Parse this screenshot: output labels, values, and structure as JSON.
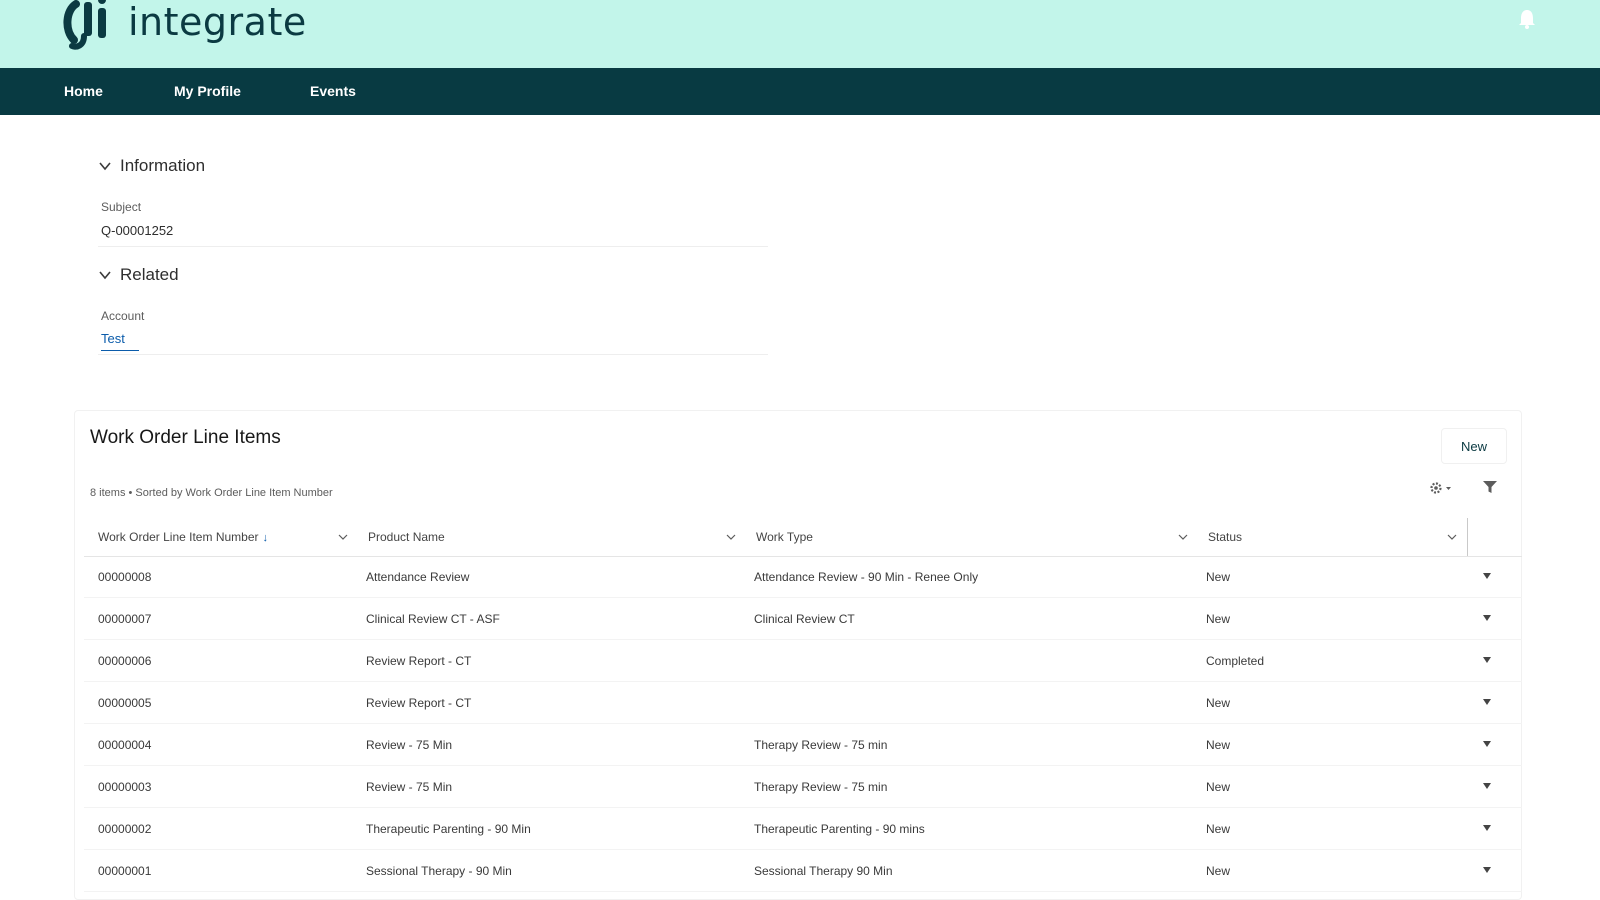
{
  "brand": {
    "name": "integrate"
  },
  "nav": {
    "items": [
      "Home",
      "My Profile",
      "Events"
    ]
  },
  "information": {
    "title": "Information",
    "subject_label": "Subject",
    "subject_value": "Q-00001252"
  },
  "related": {
    "title": "Related",
    "account_label": "Account",
    "account_value": "Test"
  },
  "work_order": {
    "title": "Work Order Line Items",
    "subtitle": "8 items • Sorted by Work Order Line Item Number",
    "new_label": "New",
    "columns": [
      "Work Order Line Item Number",
      "Product Name",
      "Work Type",
      "Status"
    ],
    "sort_indicator": "↓",
    "rows": [
      [
        "00000008",
        "Attendance Review",
        "Attendance Review - 90 Min - Renee Only",
        "New"
      ],
      [
        "00000007",
        "Clinical Review CT - ASF",
        "Clinical Review CT",
        "New"
      ],
      [
        "00000006",
        "Review Report - CT",
        "",
        "Completed"
      ],
      [
        "00000005",
        "Review Report - CT",
        "",
        "New"
      ],
      [
        "00000004",
        "Review - 75 Min",
        "Therapy Review - 75 min",
        "New"
      ],
      [
        "00000003",
        "Review - 75 Min",
        "Therapy Review - 75 min",
        "New"
      ],
      [
        "00000002",
        "Therapeutic Parenting - 90 Min",
        "Therapeutic Parenting - 90 mins",
        "New"
      ],
      [
        "00000001",
        "Sessional Therapy - 90 Min",
        "Sessional Therapy 90 Min",
        "New"
      ]
    ]
  },
  "icons": {
    "logo": "integrate-logo-icon",
    "bell": "bell-icon",
    "section_toggle": "chevron-down-icon",
    "gear": "gear-icon",
    "filter": "filter-icon",
    "row_action": "caret-down-icon"
  },
  "colors": {
    "header_bg": "#c2f5ea",
    "nav_bg": "#083a42",
    "brand_text": "#0b3a42",
    "link": "#0b5cab"
  }
}
